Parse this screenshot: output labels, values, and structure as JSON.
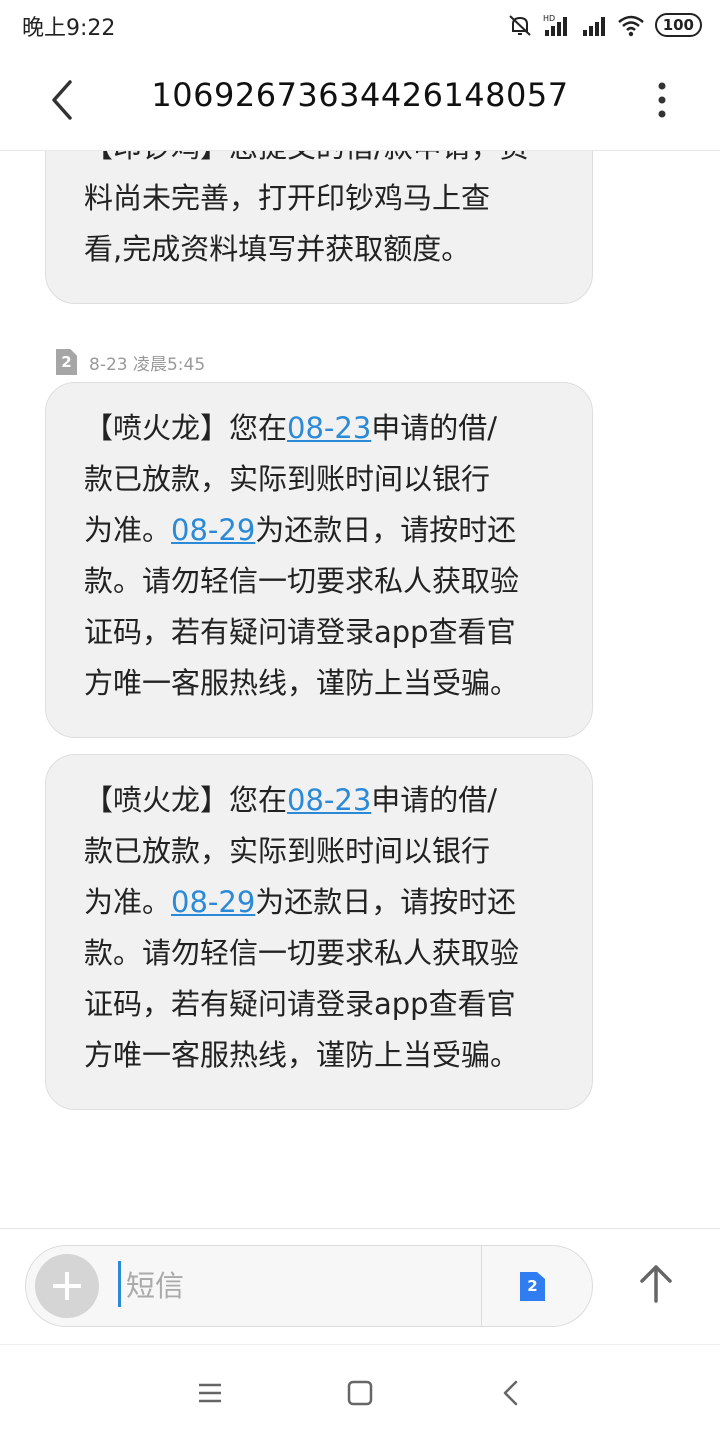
{
  "status_bar": {
    "time": "晚上9:22",
    "battery": "100",
    "icons": [
      "mute-icon",
      "hd-signal-icon",
      "signal-icon",
      "wifi-icon",
      "battery-icon"
    ]
  },
  "header": {
    "title": "1069267363442614805​7"
  },
  "messages": {
    "partial": {
      "lines": [
        "【印钞鸡】您提交的借/款申请，资",
        "料尚未完善，打开印钞鸡马上查",
        "看,完成资料填写并获取额度。"
      ]
    },
    "meta": {
      "sim": "2",
      "timestamp": "8-23 凌晨5:45"
    },
    "items": [
      {
        "l1_a": "【喷火龙】您在",
        "l1_link": "08-23",
        "l1_b": "申请的借/",
        "l2": "款已放款，实际到账时间以银行",
        "l3_a": "为准。",
        "l3_link": "08-29",
        "l3_b": "为还款日，请按时还",
        "l4": "款。请勿轻信一切要求私人获取验",
        "l5": "证码，若有疑问请登录app查看官",
        "l6": "方唯一客服热线，谨防上当受骗。"
      },
      {
        "l1_a": "【喷火龙】您在",
        "l1_link": "08-23",
        "l1_b": "申请的借/",
        "l2": "款已放款，实际到账时间以银行",
        "l3_a": "为准。",
        "l3_link": "08-29",
        "l3_b": "为还款日，请按时还",
        "l4": "款。请勿轻信一切要求私人获取验",
        "l5": "证码，若有疑问请登录app查看官",
        "l6": "方唯一客服热线，谨防上当受骗。"
      }
    ]
  },
  "compose": {
    "placeholder": "短信",
    "sim": "2"
  },
  "colors": {
    "link": "#2a8ad8",
    "bubble": "#f1f1f1",
    "sim_select": "#2f7df0"
  }
}
